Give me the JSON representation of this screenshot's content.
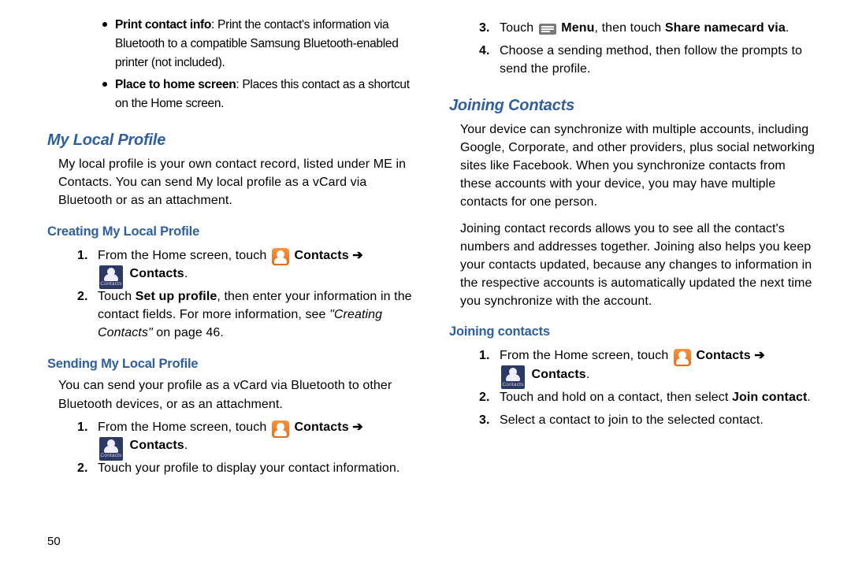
{
  "page_number": "50",
  "left": {
    "bullets": [
      {
        "lead": "Print contact info",
        "rest": ": Print the contact's information via Bluetooth to a compatible Samsung Bluetooth-enabled printer (not included)."
      },
      {
        "lead": "Place to home screen",
        "rest": ": Places this contact as a shortcut on the Home screen."
      }
    ],
    "h2_local": "My Local Profile",
    "local_para": "My local profile is your own contact record, listed under ME in Contacts. You can send My local profile as a vCard via Bluetooth or as an attachment.",
    "h3_create": "Creating My Local Profile",
    "create_steps": {
      "s1_a": "From the Home screen, touch",
      "s1_b": "Contacts ➔",
      "s1_c": "Contacts",
      "s1_d": ".",
      "s2_a": "Touch ",
      "s2_b": "Set up profile",
      "s2_c": ", then enter your information in the contact fields. For more information, see ",
      "s2_d": "\"Creating Contacts\"",
      "s2_e": " on page 46."
    },
    "h3_send": "Sending My Local Profile",
    "send_para": "You can send your profile as a vCard via Bluetooth to other Bluetooth devices, or as an attachment.",
    "send_steps": {
      "s1_a": "From the Home screen, touch",
      "s1_b": "Contacts ➔",
      "s1_c": "Contacts",
      "s1_d": ".",
      "s2": "Touch your profile to display your contact information."
    }
  },
  "right": {
    "cont_steps": {
      "s3_a": "Touch ",
      "s3_b": "Menu",
      "s3_c": ", then touch ",
      "s3_d": "Share namecard via",
      "s3_e": ".",
      "s4": "Choose a sending method, then follow the prompts to send the profile."
    },
    "h2_join": "Joining Contacts",
    "join_p1": "Your device can synchronize with multiple accounts, including Google, Corporate, and other providers, plus social networking sites like Facebook. When you synchronize contacts from these accounts with your device, you may have multiple contacts for one person.",
    "join_p2": "Joining contact records allows you to see all the contact's numbers and addresses together. Joining also helps you keep your contacts updated, because any changes to information in the respective accounts is automatically updated the next time you synchronize with the account.",
    "h3_joinc": "Joining contacts",
    "join_steps": {
      "s1_a": "From the Home screen, touch",
      "s1_b": "Contacts ➔",
      "s1_c": "Contacts",
      "s1_d": ".",
      "s2_a": "Touch and hold on a contact, then select ",
      "s2_b": "Join contact",
      "s2_c": ".",
      "s3": "Select a contact to join to the selected contact."
    }
  },
  "nums": {
    "n1": "1.",
    "n2": "2.",
    "n3": "3.",
    "n4": "4."
  },
  "icon_label": "Contacts"
}
